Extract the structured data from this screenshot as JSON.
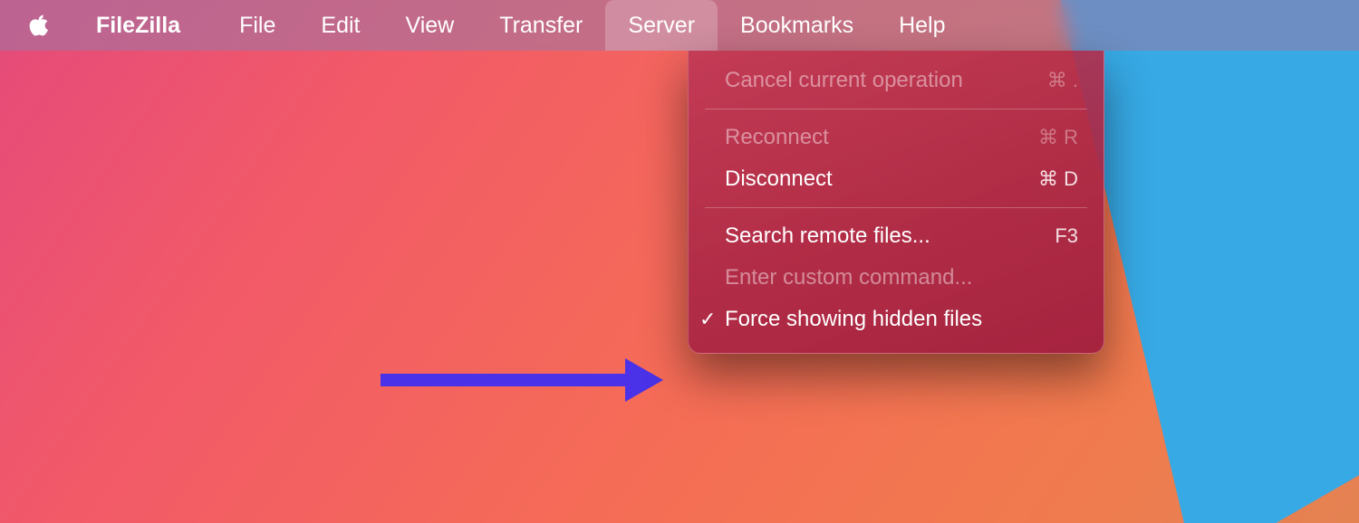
{
  "menubar": {
    "app_name": "FileZilla",
    "items": [
      "File",
      "Edit",
      "View",
      "Transfer",
      "Server",
      "Bookmarks",
      "Help"
    ],
    "active_index": 4
  },
  "dropdown": {
    "items": [
      {
        "label": "Cancel current operation",
        "shortcut": "⌘ .",
        "enabled": false,
        "checked": false
      },
      {
        "separator": true
      },
      {
        "label": "Reconnect",
        "shortcut": "⌘ R",
        "enabled": false,
        "checked": false
      },
      {
        "label": "Disconnect",
        "shortcut": "⌘ D",
        "enabled": true,
        "checked": false
      },
      {
        "separator": true
      },
      {
        "label": "Search remote files...",
        "shortcut": "F3",
        "enabled": true,
        "checked": false
      },
      {
        "label": "Enter custom command...",
        "shortcut": "",
        "enabled": false,
        "checked": false
      },
      {
        "label": "Force showing hidden files",
        "shortcut": "",
        "enabled": true,
        "checked": true
      }
    ]
  }
}
